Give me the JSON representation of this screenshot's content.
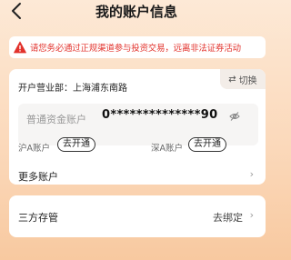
{
  "header": {
    "title": "我的账户信息",
    "back_icon": "chevron-left-icon"
  },
  "warning": {
    "icon": "warning-triangle-icon",
    "text": "请您务必通过正规渠道参与投资交易，远离非法证券活动",
    "color": "#e2322c"
  },
  "account_card": {
    "branch_label": "开户营业部：上海浦东南路",
    "switch_icon": "switch-arrows-icon",
    "switch_label": "切换",
    "fund_account": {
      "label": "普通资金账户",
      "number": "0**************90",
      "eye_icon": "eye-hidden-icon"
    },
    "shanghai_a": {
      "label": "沪A账户",
      "action": "去开通"
    },
    "shenzhen_a": {
      "label": "深A账户",
      "action": "去开通"
    },
    "more_accounts": {
      "label": "更多账户",
      "chevron": "›"
    }
  },
  "third_party": {
    "label": "三方存管",
    "action": "去绑定",
    "chevron": "›"
  }
}
